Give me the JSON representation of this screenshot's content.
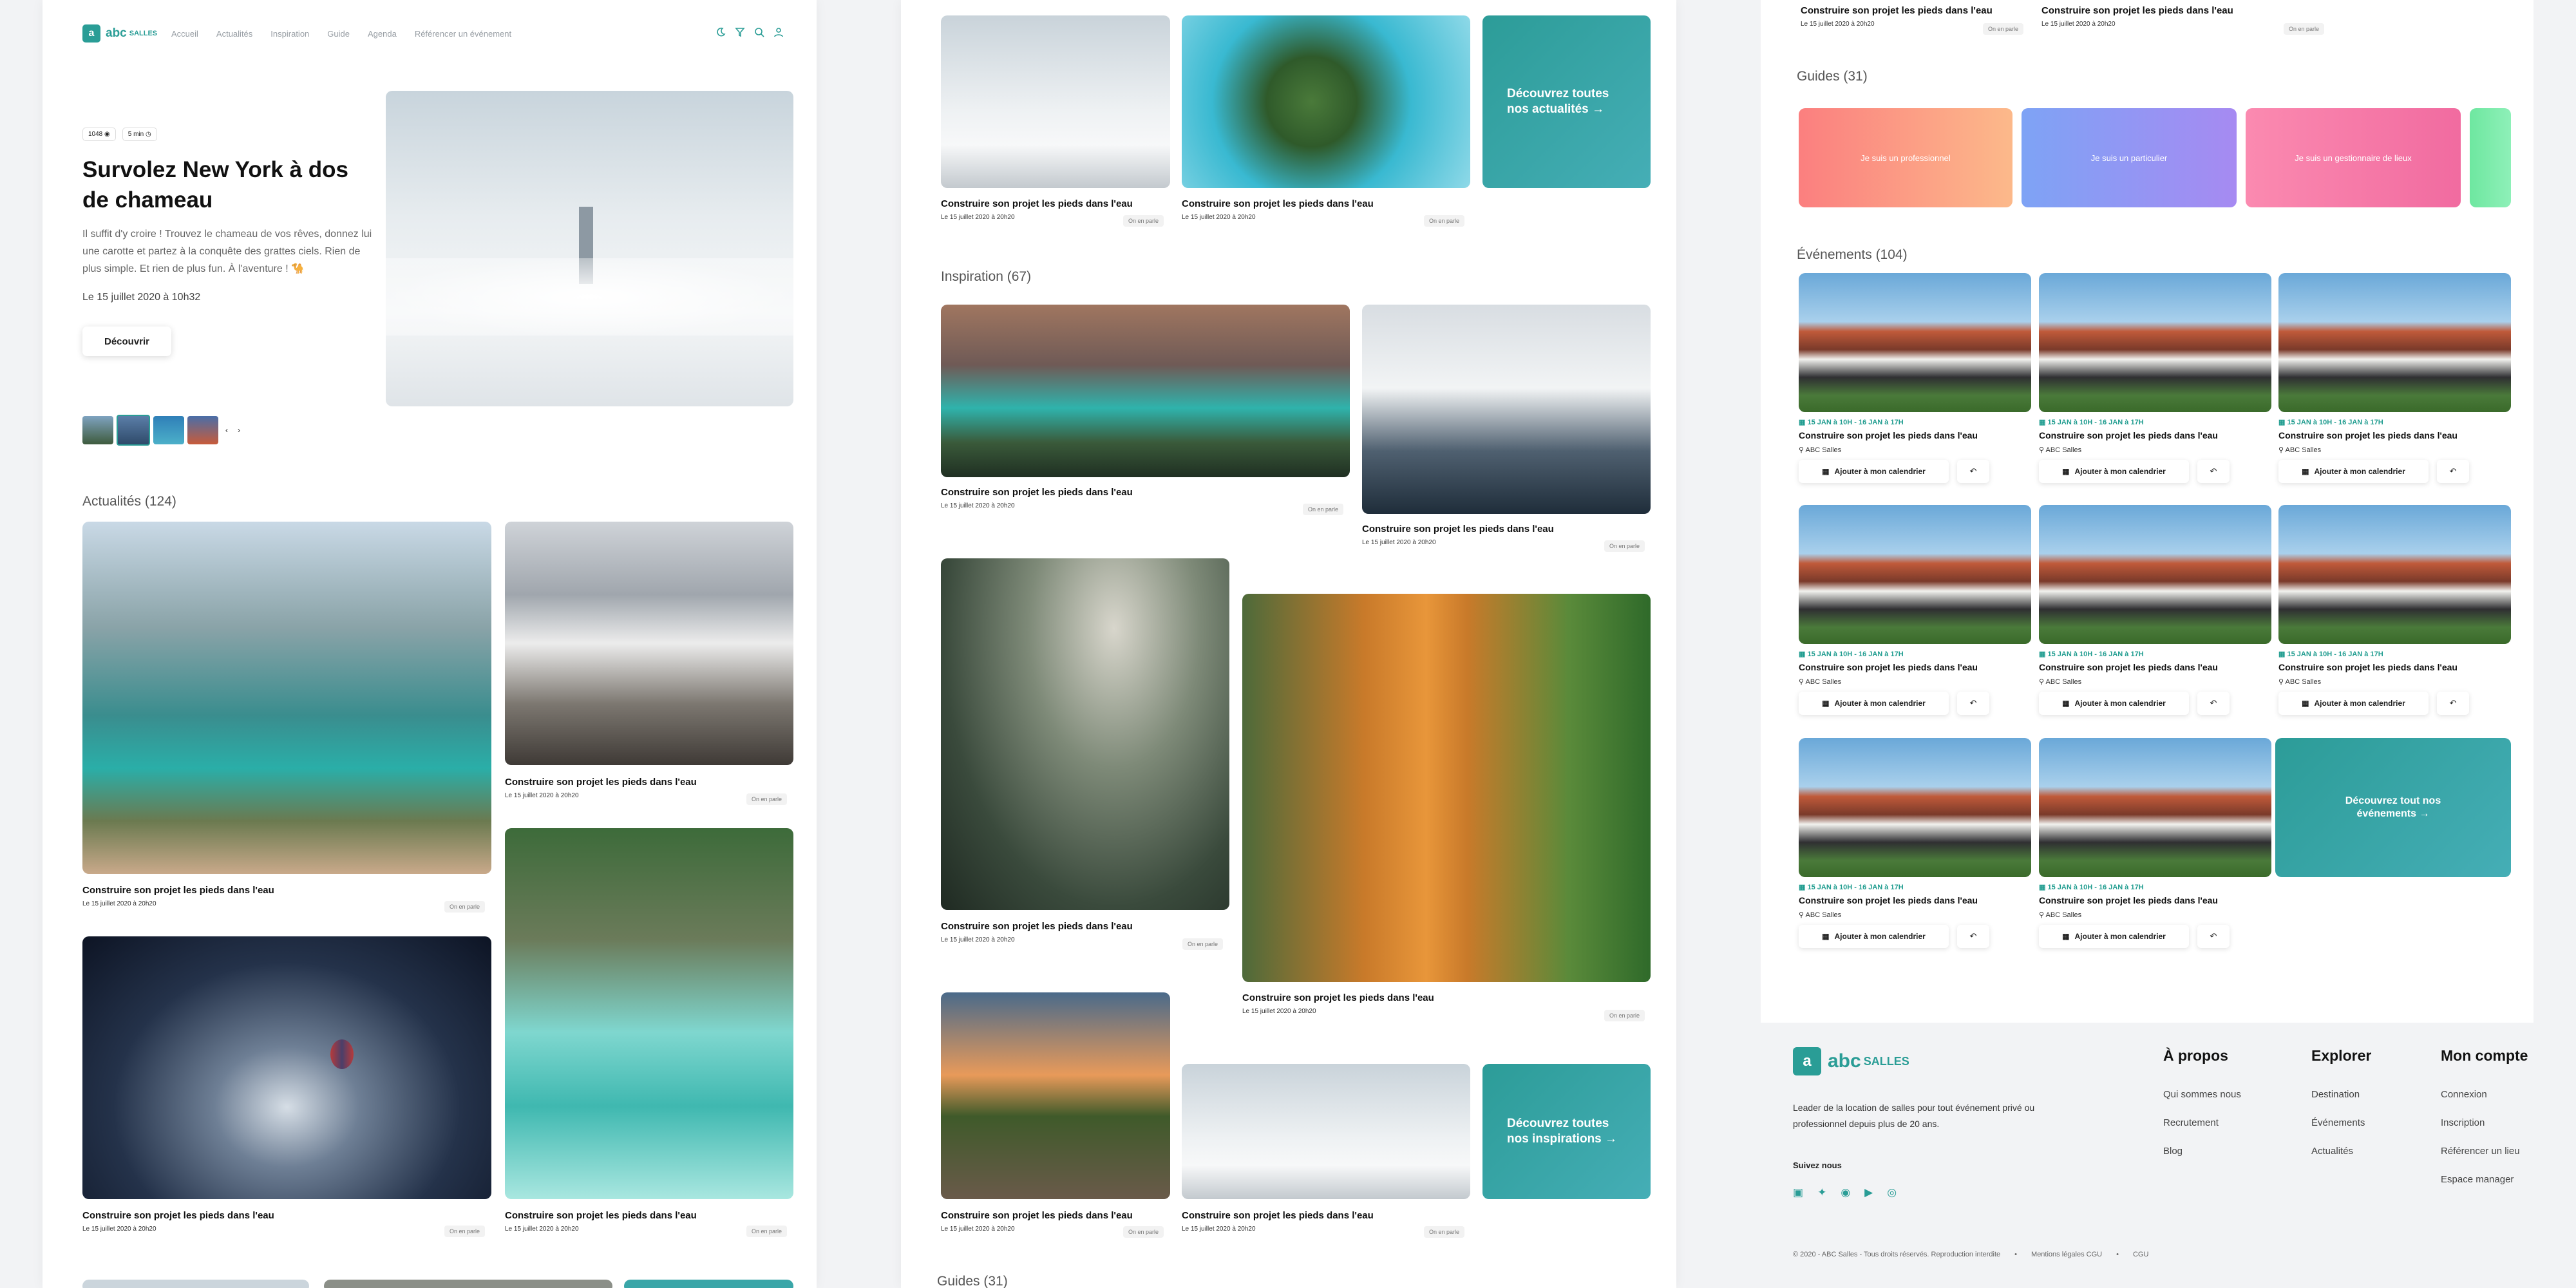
{
  "brand": {
    "logo_text": "abc",
    "logo_sub": "SALLES",
    "accent": "#2a9d96"
  },
  "nav": {
    "items": [
      "Accueil",
      "Actualités",
      "Inspiration",
      "Guide",
      "Agenda",
      "Référencer un événement"
    ]
  },
  "hero": {
    "views": "1048",
    "read_time": "5 min",
    "title": "Survolez New York à dos de chameau",
    "text": "Il suffit d'y croire ! Trouvez le chameau de vos rêves, donnez lui une carotte et partez à la conquête des grattes ciels. Rien de plus simple. Et rien de plus fun. À l'aventure ! 🐪",
    "date": "Le 15 juillet 2020 à 10h32",
    "cta": "Découvrir"
  },
  "common": {
    "card_title": "Construire son projet les pieds dans l'eau",
    "card_date": "Le 15 juillet 2020 à 20h20",
    "badge": "On en parle",
    "date_short": "Le 15 juillet 2020 à 20h20"
  },
  "sections": {
    "actualites": "Actualités (124)",
    "inspiration": "Inspiration (67)",
    "guides": "Guides (31)",
    "evenements": "Événements (104)"
  },
  "cta": {
    "actualites": "Découvrez toutes nos actualités →",
    "inspirations": "Découvrez toutes nos inspirations →",
    "evenements": "Découvrez tout nos événements →"
  },
  "guides": [
    "Je suis un professionnel",
    "Je suis un particulier",
    "Je suis un gestionnaire de lieux"
  ],
  "event": {
    "date": "15 JAN à 10H - 16 JAN à 17H",
    "title": "Construire son projet les pieds dans l'eau",
    "venue": "ABC Salles",
    "calendar": "Ajouter à mon calendrier"
  },
  "footer": {
    "tagline": "Leader de la location de salles pour tout événement privé ou professionnel depuis plus de 20 ans.",
    "follow": "Suivez nous",
    "cols": [
      {
        "title": "À propos",
        "links": [
          "Qui sommes nous",
          "Recrutement",
          "Blog"
        ]
      },
      {
        "title": "Explorer",
        "links": [
          "Destination",
          "Événements",
          "Actualités"
        ]
      },
      {
        "title": "Mon compte",
        "links": [
          "Connexion",
          "Inscription",
          "Référencer un lieu",
          "Espace manager"
        ]
      }
    ],
    "copyright": "© 2020 - ABC Salles - Tous droits réservés. Reproduction interdite",
    "legal": "Mentions légales CGU",
    "cgu": "CGU"
  },
  "icons": [
    "moon-icon",
    "filter-icon",
    "search-icon",
    "user-icon",
    "eye-icon",
    "clock-icon",
    "pin-icon",
    "calendar-icon",
    "share-icon",
    "facebook-icon",
    "twitter-icon",
    "pinterest-icon",
    "youtube-icon",
    "instagram-icon"
  ]
}
